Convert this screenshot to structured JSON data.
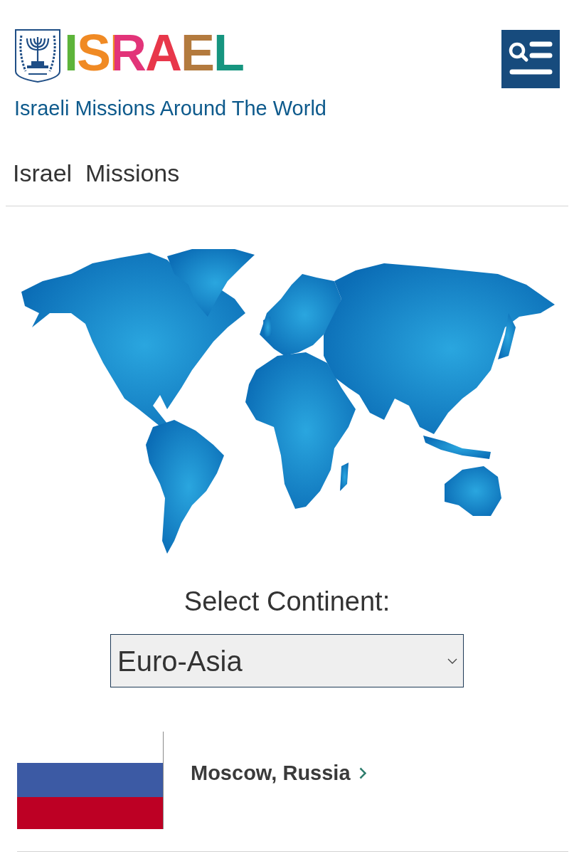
{
  "header": {
    "logo_text": "ISRAEL",
    "site_title": "Israeli Missions Around The World"
  },
  "page_title": "Israel  Missions",
  "continent_picker": {
    "label": "Select Continent:",
    "value": "Euro-Asia"
  },
  "missions": [
    {
      "name": "Moscow, Russia"
    }
  ]
}
